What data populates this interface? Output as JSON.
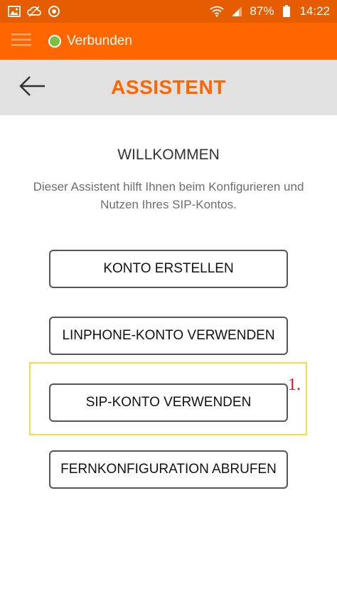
{
  "status_bar": {
    "battery": "87%",
    "time": "14:22",
    "icons": [
      "image-icon",
      "cloud-icon",
      "sync-icon",
      "wifi-icon",
      "signal-icon",
      "battery-icon"
    ]
  },
  "app_bar": {
    "connection_status": "Verbunden",
    "status_color": "#7ac143",
    "accent_color": "#ff6600"
  },
  "header": {
    "title": "ASSISTENT"
  },
  "welcome": {
    "title": "WILLKOMMEN",
    "text": "Dieser Assistent hilft Ihnen beim Konfigurieren und Nutzen Ihres SIP-Kontos."
  },
  "buttons": {
    "create_account": "KONTO ERSTELLEN",
    "use_linphone_account": "LINPHONE-KONTO VERWENDEN",
    "use_sip_account": "SIP-KONTO VERWENDEN",
    "remote_config": "FERNKONFIGURATION ABRUFEN"
  },
  "annotation": {
    "label": "1."
  }
}
